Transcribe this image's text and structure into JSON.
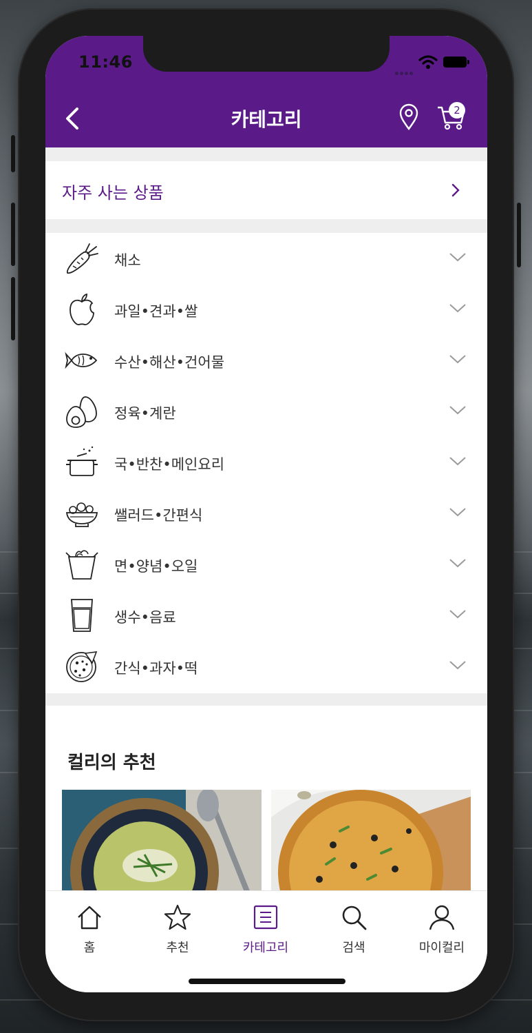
{
  "status_bar": {
    "time": "11:46"
  },
  "header": {
    "title": "카테고리",
    "cart_count": "2"
  },
  "frequent": {
    "label": "자주 사는 상품"
  },
  "categories": [
    {
      "label": "채소",
      "icon": "carrot-icon"
    },
    {
      "label": "과일•견과•쌀",
      "icon": "apple-icon"
    },
    {
      "label": "수산•해산•건어물",
      "icon": "fish-icon"
    },
    {
      "label": "정육•계란",
      "icon": "egg-icon"
    },
    {
      "label": "국•반찬•메인요리",
      "icon": "pot-icon"
    },
    {
      "label": "쌜러드•간편식",
      "icon": "salad-bowl-icon"
    },
    {
      "label": "면•양념•오일",
      "icon": "noodle-box-icon"
    },
    {
      "label": "생수•음료",
      "icon": "glass-icon"
    },
    {
      "label": "간식•과자•떡",
      "icon": "pizza-icon"
    }
  ],
  "recommend": {
    "title": "컬리의 추천"
  },
  "tabs": [
    {
      "label": "홈",
      "icon": "home-icon"
    },
    {
      "label": "추천",
      "icon": "star-icon"
    },
    {
      "label": "카테고리",
      "icon": "list-icon",
      "active": true
    },
    {
      "label": "검색",
      "icon": "search-icon"
    },
    {
      "label": "마이컬리",
      "icon": "person-icon"
    }
  ],
  "colors": {
    "brand": "#5a1a88",
    "gap": "#eeeeee"
  }
}
